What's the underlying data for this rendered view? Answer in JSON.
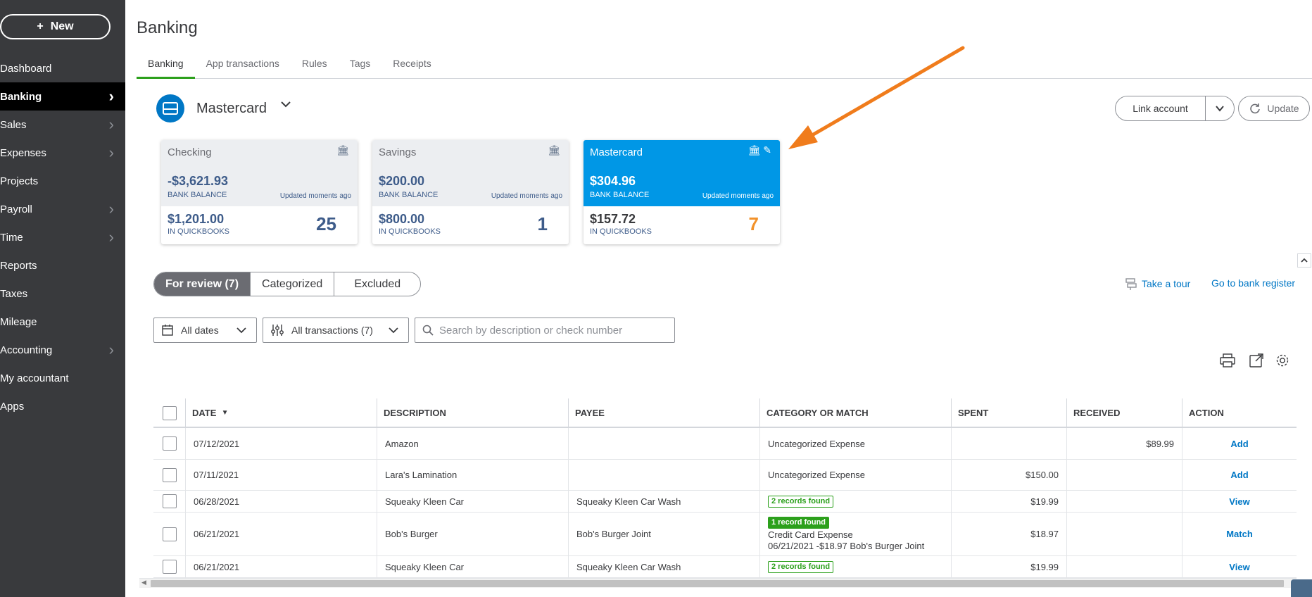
{
  "sidebar": {
    "new_label": "New",
    "items": [
      {
        "label": "Dashboard",
        "chevron": false,
        "active": false
      },
      {
        "label": "Banking",
        "chevron": true,
        "active": true
      },
      {
        "label": "Sales",
        "chevron": true,
        "active": false
      },
      {
        "label": "Expenses",
        "chevron": true,
        "active": false
      },
      {
        "label": "Projects",
        "chevron": false,
        "active": false
      },
      {
        "label": "Payroll",
        "chevron": true,
        "active": false
      },
      {
        "label": "Time",
        "chevron": true,
        "active": false
      },
      {
        "label": "Reports",
        "chevron": false,
        "active": false
      },
      {
        "label": "Taxes",
        "chevron": false,
        "active": false
      },
      {
        "label": "Mileage",
        "chevron": false,
        "active": false
      },
      {
        "label": "Accounting",
        "chevron": true,
        "active": false
      },
      {
        "label": "My accountant",
        "chevron": false,
        "active": false
      },
      {
        "label": "Apps",
        "chevron": false,
        "active": false
      }
    ]
  },
  "page": {
    "title": "Banking",
    "tabs": [
      "Banking",
      "App transactions",
      "Rules",
      "Tags",
      "Receipts"
    ],
    "active_tab": "Banking"
  },
  "account_header": {
    "name": "Mastercard",
    "link_account_label": "Link account",
    "update_label": "Update"
  },
  "cards": [
    {
      "name": "Checking",
      "bank_balance": "-$3,621.93",
      "bank_balance_label": "BANK BALANCE",
      "updated": "Updated moments ago",
      "qb_balance": "$1,201.00",
      "qb_label": "IN QUICKBOOKS",
      "count": "25",
      "selected": false
    },
    {
      "name": "Savings",
      "bank_balance": "$200.00",
      "bank_balance_label": "BANK BALANCE",
      "updated": "Updated moments ago",
      "qb_balance": "$800.00",
      "qb_label": "IN QUICKBOOKS",
      "count": "1",
      "selected": false
    },
    {
      "name": "Mastercard",
      "bank_balance": "$304.96",
      "bank_balance_label": "BANK BALANCE",
      "updated": "Updated moments ago",
      "qb_balance": "$157.72",
      "qb_label": "IN QUICKBOOKS",
      "count": "7",
      "selected": true
    }
  ],
  "review_tabs": [
    "For review (7)",
    "Categorized",
    "Excluded"
  ],
  "links": {
    "take_tour": "Take a tour",
    "bank_register": "Go to bank register"
  },
  "filters": {
    "dates": "All dates",
    "transactions": "All transactions (7)",
    "search_placeholder": "Search by description or check number"
  },
  "table": {
    "columns": [
      "DATE",
      "DESCRIPTION",
      "PAYEE",
      "CATEGORY OR MATCH",
      "SPENT",
      "RECEIVED",
      "ACTION"
    ],
    "rows": [
      {
        "date": "07/12/2021",
        "description": "Amazon",
        "payee": "",
        "category": "Uncategorized Expense",
        "badge": "",
        "match_line1": "",
        "match_line2": "",
        "spent": "",
        "received": "$89.99",
        "action": "Add"
      },
      {
        "date": "07/11/2021",
        "description": "Lara's Lamination",
        "payee": "",
        "category": "Uncategorized Expense",
        "badge": "",
        "match_line1": "",
        "match_line2": "",
        "spent": "$150.00",
        "received": "",
        "action": "Add"
      },
      {
        "date": "06/28/2021",
        "description": "Squeaky Kleen Car",
        "payee": "Squeaky Kleen Car Wash",
        "category": "",
        "badge": "2 records found",
        "match_line1": "",
        "match_line2": "",
        "spent": "$19.99",
        "received": "",
        "action": "View"
      },
      {
        "date": "06/21/2021",
        "description": "Bob's Burger",
        "payee": "Bob's Burger Joint",
        "category": "",
        "badge": "1 record found",
        "match_line1": "Credit Card Expense",
        "match_line2": "06/21/2021 -$18.97 Bob's Burger Joint",
        "spent": "$18.97",
        "received": "",
        "action": "Match"
      },
      {
        "date": "06/21/2021",
        "description": "Squeaky Kleen Car",
        "payee": "Squeaky Kleen Car Wash",
        "category": "",
        "badge": "2 records found",
        "match_line1": "",
        "match_line2": "",
        "spent": "$19.99",
        "received": "",
        "action": "View"
      }
    ]
  },
  "colors": {
    "sidebar_bg": "#393a3d",
    "active_nav": "#000000",
    "accent_green": "#2ca01c",
    "link_blue": "#0077c5",
    "selected_card": "#0097e6",
    "count_orange": "#f2922b",
    "annotation_arrow": "#f07c1c"
  }
}
